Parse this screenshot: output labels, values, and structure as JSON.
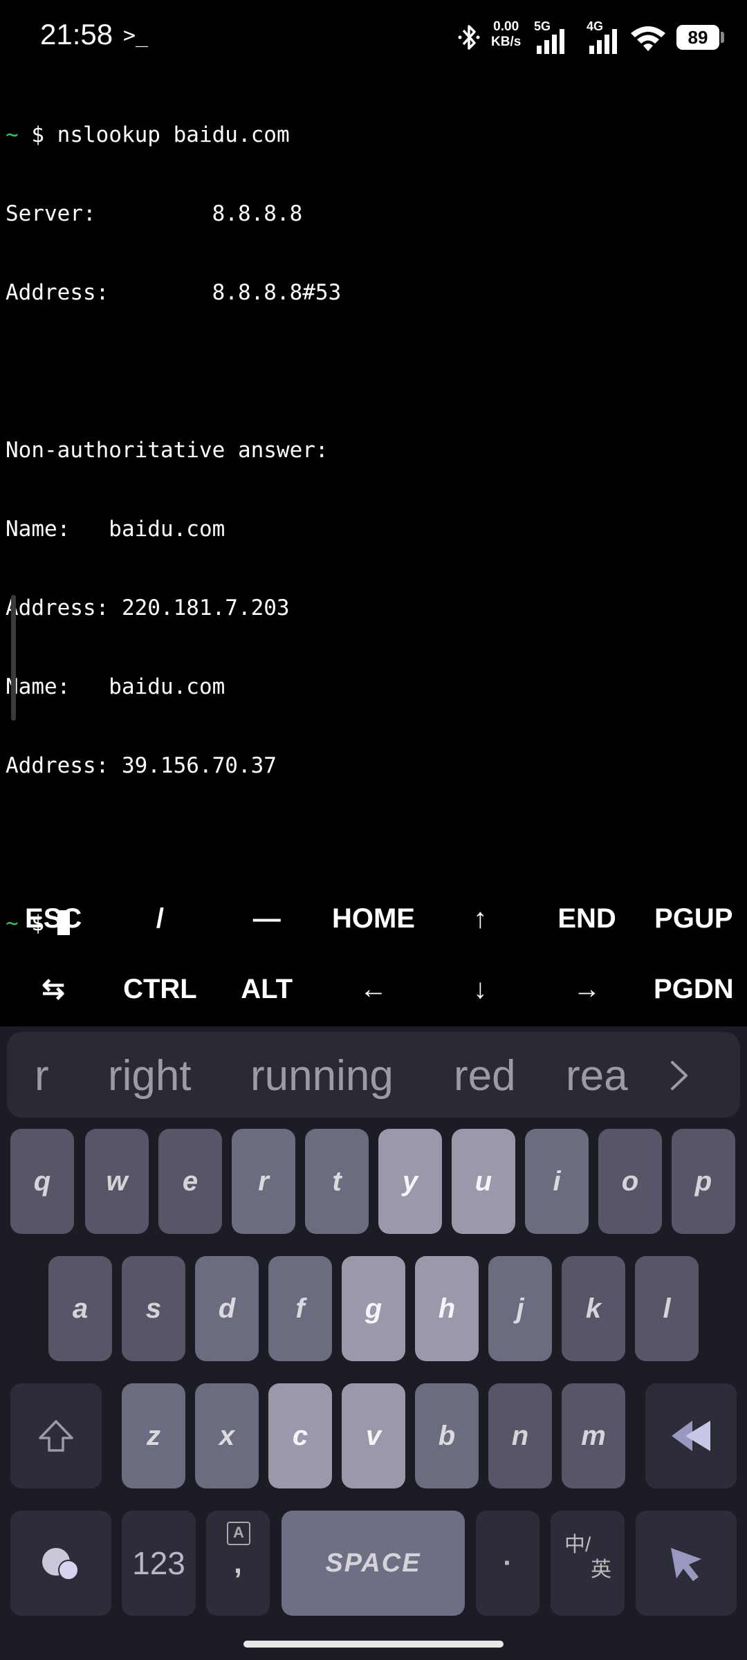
{
  "status_bar": {
    "time": "21:58",
    "prompt_icon": ">_",
    "speed_value": "0.00",
    "speed_unit": "KB/s",
    "net1": "5G",
    "net2": "4G",
    "battery": "89"
  },
  "terminal": {
    "lines": [
      {
        "prefix": "~",
        "text": " $ nslookup baidu.com"
      },
      {
        "prefix": "",
        "text": "Server:         8.8.8.8"
      },
      {
        "prefix": "",
        "text": "Address:        8.8.8.8#53"
      },
      {
        "prefix": "",
        "text": ""
      },
      {
        "prefix": "",
        "text": "Non-authoritative answer:"
      },
      {
        "prefix": "",
        "text": "Name:   baidu.com"
      },
      {
        "prefix": "",
        "text": "Address: 220.181.7.203"
      },
      {
        "prefix": "",
        "text": "Name:   baidu.com"
      },
      {
        "prefix": "",
        "text": "Address: 39.156.70.37"
      },
      {
        "prefix": "",
        "text": ""
      }
    ],
    "prompt_tilde": "~",
    "prompt_symbol": " $ "
  },
  "extra_keys": {
    "row1": [
      "ESC",
      "/",
      "—",
      "HOME",
      "↑",
      "END",
      "PGUP"
    ],
    "row2": [
      "⇆",
      "CTRL",
      "ALT",
      "←",
      "↓",
      "→",
      "PGDN"
    ]
  },
  "keyboard": {
    "suggestions": [
      "r",
      "right",
      "running",
      "red",
      "rea"
    ],
    "row1": [
      "q",
      "w",
      "e",
      "r",
      "t",
      "y",
      "u",
      "i",
      "o",
      "p"
    ],
    "row2": [
      "a",
      "s",
      "d",
      "f",
      "g",
      "h",
      "j",
      "k",
      "l"
    ],
    "row3": [
      "z",
      "x",
      "c",
      "v",
      "b",
      "n",
      "m"
    ],
    "num_label": "123",
    "comma_sub": "A",
    "comma_label": ",",
    "space_label": "SPACE",
    "period_label": "·",
    "lang_top": "中/",
    "lang_bottom": "英"
  }
}
